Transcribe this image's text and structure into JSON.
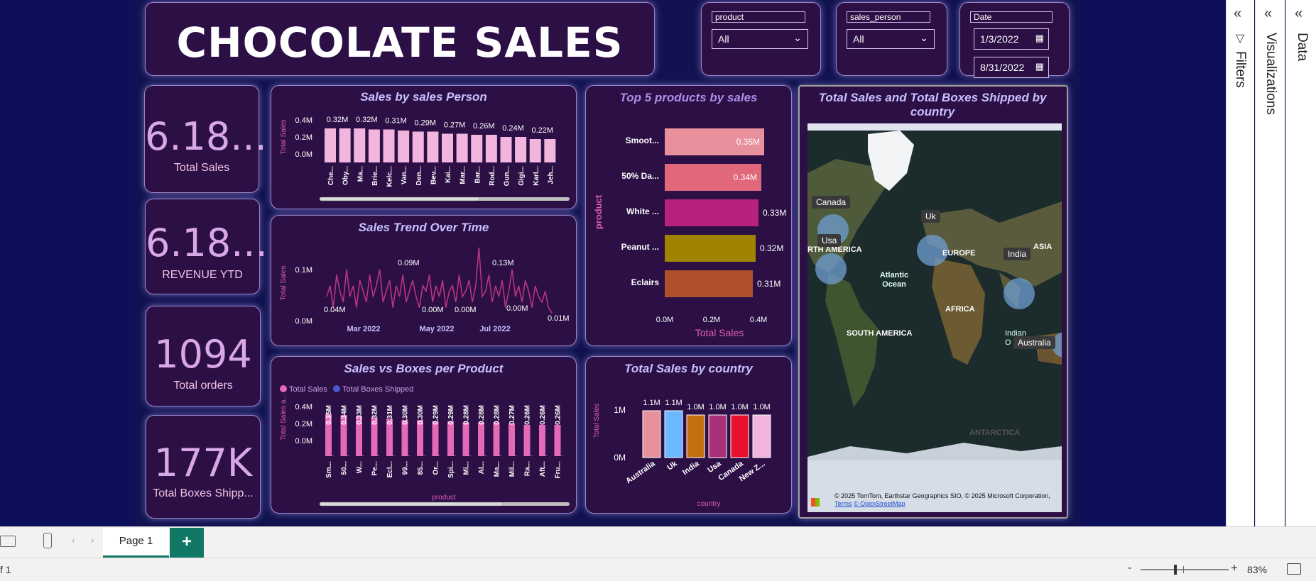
{
  "header": {
    "title": "CHOCOLATE SALES"
  },
  "slicers": [
    {
      "label": "product",
      "value": "All"
    },
    {
      "label": "sales_person",
      "value": "All"
    }
  ],
  "date_slicer": {
    "label": "Date",
    "start": "1/3/2022",
    "end": "8/31/2022"
  },
  "kpis": [
    {
      "value": "6.18...",
      "label": "Total Sales"
    },
    {
      "value": "6.18...",
      "label": "REVENUE YTD"
    },
    {
      "value": "1094",
      "label": "Total orders"
    },
    {
      "value": "177K",
      "label": "Total Boxes Shipp..."
    }
  ],
  "chart_titles": {
    "sales_person": "Sales by sales Person",
    "trend": "Sales Trend Over Time",
    "boxes": "Sales vs Boxes per Product",
    "top5": "Top 5 products by sales",
    "country": "Total Sales by country",
    "map": "Total Sales and Total Boxes Shipped by country"
  },
  "chart_data": [
    {
      "type": "bar",
      "id": "sales_person",
      "ylabel": "Total Sales",
      "ylim": [
        0,
        0.4
      ],
      "yticks": [
        "0.4M",
        "0.2M",
        "0.0M"
      ],
      "categories": [
        "Che...",
        "Oby...",
        "Ma...",
        "Brie...",
        "Kelc...",
        "Van...",
        "Den...",
        "Bev...",
        "Kai...",
        "Mar...",
        "Bar...",
        "Rod...",
        "Gun...",
        "Gigi...",
        "Karl...",
        "Jeh..."
      ],
      "values": [
        0.32,
        0.32,
        0.32,
        0.31,
        0.31,
        0.3,
        0.29,
        0.29,
        0.27,
        0.27,
        0.26,
        0.26,
        0.24,
        0.24,
        0.22,
        0.22
      ],
      "labels": [
        "0.32M",
        "",
        "0.32M",
        "",
        "0.31M",
        "",
        "0.29M",
        "",
        "0.27M",
        "",
        "0.26M",
        "",
        "0.24M",
        "",
        "0.22M",
        ""
      ],
      "color": "#f2b6de"
    },
    {
      "type": "line",
      "id": "trend",
      "ylabel": "Total Sales",
      "yticks": [
        "0.1M",
        "0.0M"
      ],
      "ylim": [
        0,
        0.13
      ],
      "xticks": [
        "Mar 2022",
        "May 2022",
        "Jul 2022"
      ],
      "annotations": [
        "0.04M",
        "0.09M",
        "0.00M",
        "0.00M",
        "0.13M",
        "0.00M",
        "0.01M"
      ],
      "values": [
        0.04,
        0.06,
        0.02,
        0.08,
        0.05,
        0.03,
        0.09,
        0.04,
        0.06,
        0.02,
        0.07,
        0.05,
        0.03,
        0.08,
        0.04,
        0.06,
        0.09,
        0.03,
        0.05,
        0.07,
        0.02,
        0.06,
        0.04,
        0.08,
        0.03,
        0.05,
        0.07,
        0.04,
        0.02,
        0.06,
        0.05,
        0.08,
        0.03,
        0.06,
        0.04,
        0.07,
        0.02,
        0.05,
        0.06,
        0.03,
        0.08,
        0.04,
        0.05,
        0.07,
        0.03,
        0.06,
        0.13,
        0.04,
        0.05,
        0.08,
        0.03,
        0.06,
        0.04,
        0.07,
        0.02,
        0.05,
        0.09,
        0.04,
        0.06,
        0.03,
        0.07,
        0.05,
        0.02,
        0.06,
        0.04,
        0.03,
        0.05,
        0.02,
        0.01
      ],
      "color": "#b8357f"
    },
    {
      "type": "bar",
      "id": "boxes",
      "ylabel": "Total Sales a...",
      "xlabel": "product",
      "ylim": [
        0,
        0.4
      ],
      "yticks": [
        "0.4M",
        "0.2M",
        "0.0M"
      ],
      "legend": [
        "Total Sales",
        "Total Boxes Shipped"
      ],
      "categories": [
        "Sm...",
        "50...",
        "W...",
        "Pe...",
        "Ecl...",
        "99...",
        "85...",
        "Or...",
        "Spi...",
        "Mi...",
        "Al...",
        "Ma...",
        "Mil...",
        "Ra...",
        "Aft...",
        "Fru..."
      ],
      "values": [
        0.35,
        0.34,
        0.33,
        0.32,
        0.31,
        0.3,
        0.3,
        0.29,
        0.29,
        0.28,
        0.28,
        0.28,
        0.27,
        0.26,
        0.26,
        0.26
      ],
      "labels": [
        "0.35M",
        "0.34M",
        "0.33M",
        "0.32M",
        "0.31M",
        "0.30M",
        "0.30M",
        "0.29M",
        "0.29M",
        "0.28M",
        "0.28M",
        "0.28M",
        "0.27M",
        "0.26M",
        "0.26M",
        "0.26M"
      ],
      "color": "#e46ab8"
    },
    {
      "type": "bar",
      "id": "top5",
      "orientation": "horizontal",
      "ylabel": "product",
      "xlabel": "Total Sales",
      "xticks": [
        "0.0M",
        "0.2M",
        "0.4M"
      ],
      "xlim": [
        0,
        0.4
      ],
      "categories": [
        "Smoot...",
        "50% Da...",
        "White ...",
        "Peanut ...",
        "Eclairs"
      ],
      "values": [
        0.35,
        0.34,
        0.33,
        0.32,
        0.31
      ],
      "labels": [
        "0.35M",
        "0.34M",
        "0.33M",
        "0.32M",
        "0.31M"
      ],
      "colors": [
        "#e8909c",
        "#e0687a",
        "#b8227e",
        "#a08400",
        "#b0502a"
      ]
    },
    {
      "type": "bar",
      "id": "country",
      "ylabel": "Total Sales",
      "xlabel": "country",
      "yticks": [
        "1M",
        "0M"
      ],
      "ylim": [
        0,
        1.2
      ],
      "categories": [
        "Australia",
        "Uk",
        "India",
        "Usa",
        "Canada",
        "New Z..."
      ],
      "values": [
        1.1,
        1.1,
        1.0,
        1.0,
        1.0,
        1.0
      ],
      "labels": [
        "1.1M",
        "1.1M",
        "1.0M",
        "1.0M",
        "1.0M",
        "1.0M"
      ],
      "colors": [
        "#e8909c",
        "#6ab8ff",
        "#c47010",
        "#a8307a",
        "#e8102e",
        "#f2b6de"
      ]
    }
  ],
  "map": {
    "labels": [
      "Canada",
      "Usa",
      "Uk",
      "India",
      "Australia"
    ],
    "regions": [
      "RTH AMERICA",
      "EUROPE",
      "ASIA",
      "Atlantic Ocean",
      "AFRICA",
      "SOUTH AMERICA",
      "Indian O",
      "ANTARCTICA"
    ],
    "copyright": "© 2025 TomTom, Earthstar Geographics SIO, © 2025 Microsoft Corporation,",
    "terms": "Terms",
    "osm": "© OpenStreetMap"
  },
  "panes": {
    "filters": "Filters",
    "visualizations": "Visualizations",
    "data": "Data"
  },
  "pages": {
    "current": "Page 1",
    "add": "+"
  },
  "status": {
    "page_info": "f 1",
    "zoom": "83%",
    "zoom_minus": "-",
    "zoom_plus": "+"
  }
}
